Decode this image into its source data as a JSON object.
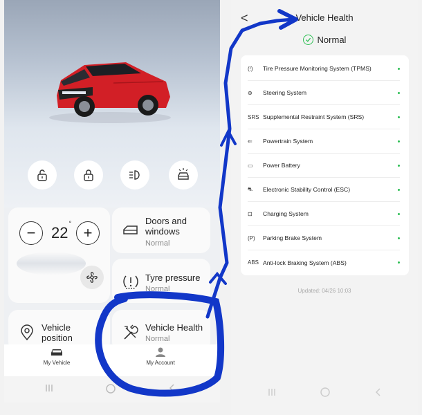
{
  "left_app": {
    "climate": {
      "decrease_label": "−",
      "increase_label": "+",
      "temperature": "22",
      "degree": "°"
    },
    "cards": {
      "doors": {
        "title": "Doors and windows",
        "status": "Normal"
      },
      "tyre": {
        "title": "Tyre pressure",
        "status": "Normal"
      },
      "position": {
        "title": "Vehicle position"
      },
      "health": {
        "title": "Vehicle Health",
        "status": "Normal"
      }
    },
    "tabs": {
      "my_vehicle": "My Vehicle",
      "my_account": "My Account"
    }
  },
  "right_app": {
    "header": {
      "back": "<",
      "title": "Vehicle Health"
    },
    "overall_status": "Normal",
    "systems": [
      {
        "icon_text": "(!)",
        "label": "Tire Pressure Monitoring System (TPMS)"
      },
      {
        "icon_text": "⊛",
        "label": "Steering System"
      },
      {
        "icon_text": "SRS",
        "label": "Supplemental Restraint System (SRS)"
      },
      {
        "icon_text": "⇐",
        "label": "Powertrain System"
      },
      {
        "icon_text": "▭",
        "label": "Power Battery"
      },
      {
        "icon_text": "⛐",
        "label": "Electronic Stability Control (ESC)"
      },
      {
        "icon_text": "⊡",
        "label": "Charging System"
      },
      {
        "icon_text": "(P)",
        "label": "Parking Brake System"
      },
      {
        "icon_text": "ABS",
        "label": "Anti-lock Braking System (ABS)"
      }
    ],
    "updated": "Updated: 04/26 10:03"
  },
  "colors": {
    "ok_green": "#2fbf55",
    "annotation_blue": "#1237c8",
    "car_red": "#d21f26"
  }
}
